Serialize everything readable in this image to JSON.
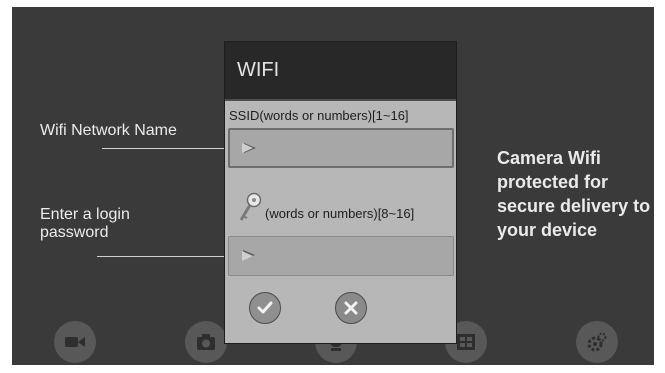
{
  "dialog": {
    "title": "WIFI",
    "ssid_label": "SSID(words or numbers)[1~16]",
    "ssid_value": "",
    "password_hint": "(words or numbers)[8~16]",
    "password_value": "",
    "confirm_icon": "check-icon",
    "cancel_icon": "close-icon"
  },
  "annotations": {
    "network_name": "Wifi Network Name",
    "password": "Enter a login password",
    "promo": "Camera Wifi protected for secure delivery to your device"
  },
  "toolbar": {
    "icons": [
      "video-camera-icon",
      "camera-icon",
      "webcam-icon",
      "gallery-icon",
      "settings-gear-icon"
    ]
  },
  "colors": {
    "background": "#3a3a3a",
    "dialog_body": "#b7b7b7",
    "dialog_title_bar": "#282828"
  }
}
